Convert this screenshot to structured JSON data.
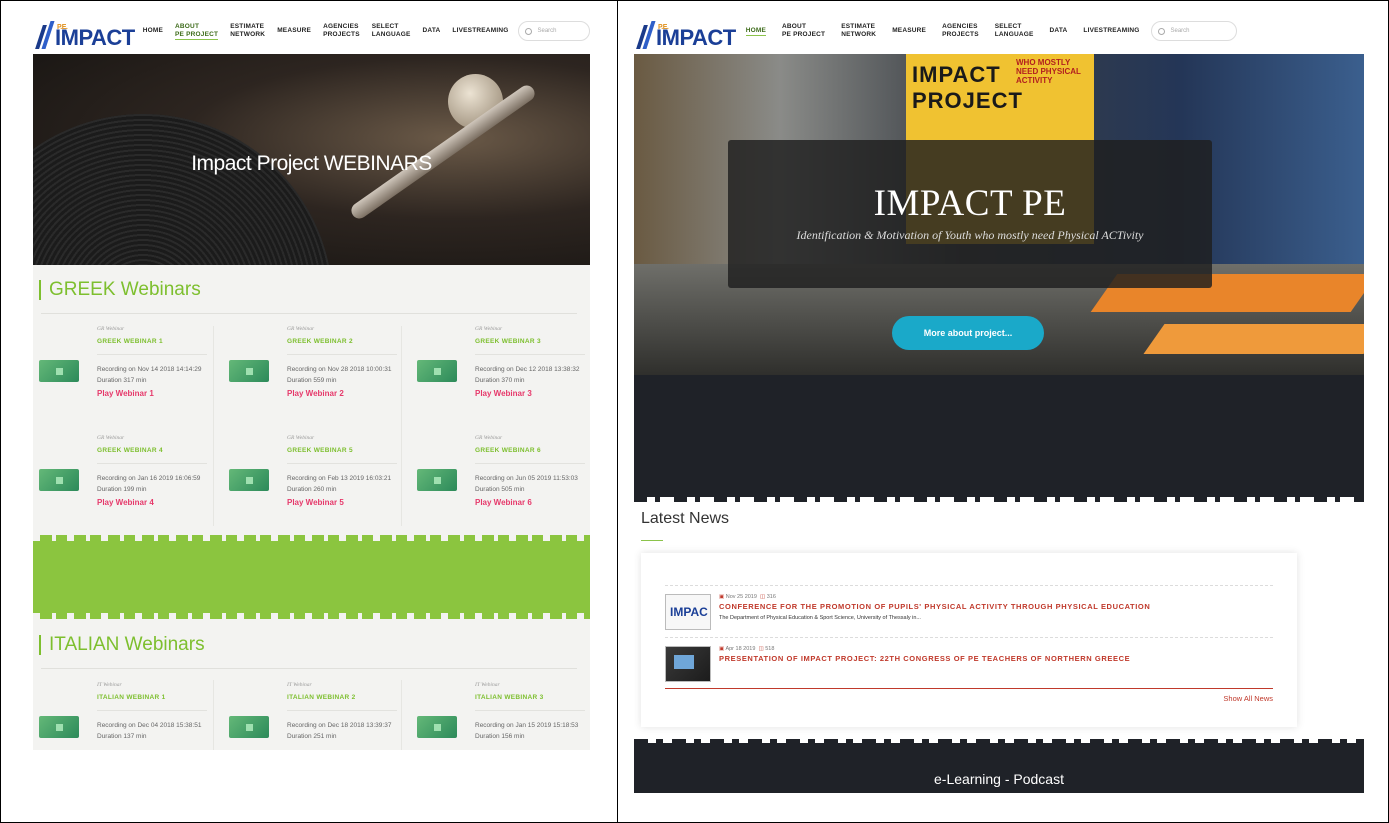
{
  "nav": {
    "logo_small": "P.E.",
    "logo_text": "IMPACT",
    "items": [
      {
        "line1": "HOME",
        "line2": ""
      },
      {
        "line1": "ABOUT",
        "line2": "PE PROJECT"
      },
      {
        "line1": "ESTIMATE",
        "line2": "NETWORK"
      },
      {
        "line1": "MEASURE",
        "line2": ""
      },
      {
        "line1": "AGENCIES",
        "line2": "PROJECTS"
      },
      {
        "line1": "SELECT",
        "line2": "LANGUAGE"
      },
      {
        "line1": "DATA",
        "line2": ""
      },
      {
        "line1": "LIVESTREAMING",
        "line2": ""
      }
    ],
    "search_placeholder": "Search"
  },
  "left": {
    "hero_title": "Impact Project WEBINARS",
    "greek": {
      "title": "GREEK Webinars",
      "cards": [
        {
          "kicker": "GR Webinar",
          "name": "GREEK WEBINAR 1",
          "rec": "Recording on Nov 14 2018 14:14:29",
          "dur": "Duration 317 min",
          "play": "Play Webinar 1"
        },
        {
          "kicker": "GR Webinar",
          "name": "GREEK WEBINAR 2",
          "rec": "Recording on Nov 28 2018 10:00:31",
          "dur": "Duration 559 min",
          "play": "Play Webinar 2"
        },
        {
          "kicker": "GR Webinar",
          "name": "GREEK WEBINAR 3",
          "rec": "Recording on Dec 12 2018 13:38:32",
          "dur": "Duration 370 min",
          "play": "Play Webinar 3"
        },
        {
          "kicker": "GR Webinar",
          "name": "GREEK WEBINAR 4",
          "rec": "Recording on Jan 16 2019 16:06:59",
          "dur": "Duration 199 min",
          "play": "Play Webinar 4"
        },
        {
          "kicker": "GR Webinar",
          "name": "GREEK WEBINAR 5",
          "rec": "Recording on Feb 13 2019 16:03:21",
          "dur": "Duration 260 min",
          "play": "Play Webinar 5"
        },
        {
          "kicker": "GR Webinar",
          "name": "GREEK WEBINAR 6",
          "rec": "Recording on Jun 05 2019 11:53:03",
          "dur": "Duration 505 min",
          "play": "Play Webinar 6"
        }
      ]
    },
    "italian": {
      "title": "ITALIAN Webinars",
      "cards": [
        {
          "kicker": "IT Webinar",
          "name": "ITALIAN WEBINAR 1",
          "rec": "Recording on Dec 04 2018 15:38:51",
          "dur": "Duration 137 min"
        },
        {
          "kicker": "IT Webinar",
          "name": "ITALIAN WEBINAR 2",
          "rec": "Recording on Dec 18 2018 13:39:37",
          "dur": "Duration 251 min"
        },
        {
          "kicker": "IT Webinar",
          "name": "ITALIAN WEBINAR 3",
          "rec": "Recording on Jan 15 2019 15:18:53",
          "dur": "Duration 156 min"
        }
      ]
    }
  },
  "right": {
    "poster_text": "IMPACT PROJECT",
    "poster_sub": "WHO MOSTLY NEED PHYSICAL ACTIVITY",
    "hero_title": "IMPACT PE",
    "hero_subtitle": "Identification & Motivation of Youth who mostly need Physical ACTivity",
    "hero_button": "More about project...",
    "news_title": "Latest News",
    "news": [
      {
        "date": "Nov 25 2019",
        "views": "316",
        "headline": "CONFERENCE FOR THE PROMOTION OF PUPILS' PHYSICAL ACTIVITY THROUGH PHYSICAL EDUCATION",
        "excerpt": "The Department of Physical Education & Sport Science, University of Thessaly in...",
        "thumb_text": "IMPAC"
      },
      {
        "date": "Apr 18 2019",
        "views": "518",
        "headline": "PRESENTATION OF IMPACT PROJECT: 22TH CONGRESS OF PE TEACHERS OF NORTHERN GREECE",
        "excerpt": "",
        "thumb_text": ""
      }
    ],
    "show_all": "Show All News",
    "bottom_title": "e-Learning - Podcast"
  },
  "colors": {
    "accent_green": "#7dbf2e",
    "play_pink": "#e6396b",
    "news_red": "#c0392b",
    "button_teal": "#1aa9c9"
  }
}
